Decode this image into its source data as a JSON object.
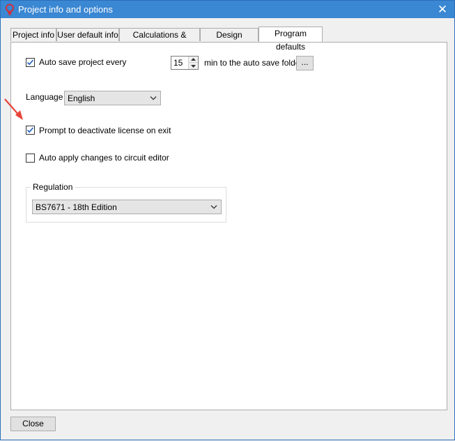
{
  "window": {
    "title": "Project info and options"
  },
  "tabs": [
    {
      "label": "Project info"
    },
    {
      "label": "User default info"
    },
    {
      "label": "Calculations & Checks"
    },
    {
      "label": "Design defaults"
    },
    {
      "label": "Program defaults",
      "active": true
    }
  ],
  "program_defaults": {
    "auto_save": {
      "label": "Auto save project every",
      "checked": true,
      "minutes": "15",
      "suffix": "min to the auto save folder",
      "browse_label": "..."
    },
    "language": {
      "label": "Language",
      "selected": "English"
    },
    "prompt_deactivate": {
      "label": "Prompt to deactivate license on exit",
      "checked": true
    },
    "auto_apply": {
      "label": "Auto apply changes to circuit editor",
      "checked": false
    },
    "regulation": {
      "title": "Regulation",
      "selected": "BS7671 - 18th Edition"
    }
  },
  "footer": {
    "close_label": "Close"
  },
  "colors": {
    "titlebar": "#3a87d3",
    "annotation_arrow": "#e8433a",
    "check": "#1f5fbf"
  },
  "icons": [
    "app-bulb-icon",
    "close-icon",
    "check-icon",
    "chevron-down-icon",
    "spin-up-icon",
    "spin-down-icon",
    "annotation-arrow-icon"
  ]
}
